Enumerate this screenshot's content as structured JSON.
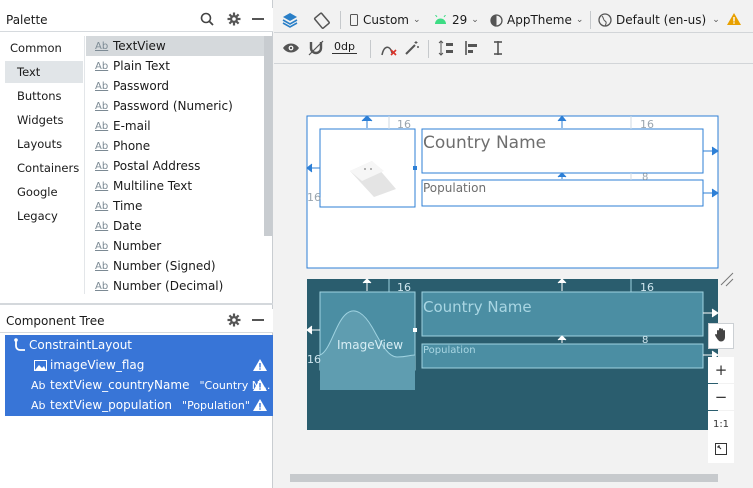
{
  "palette": {
    "title": "Palette",
    "categories": [
      "Common",
      "Text",
      "Buttons",
      "Widgets",
      "Layouts",
      "Containers",
      "Google",
      "Legacy"
    ],
    "items": [
      "TextView",
      "Plain Text",
      "Password",
      "Password (Numeric)",
      "E-mail",
      "Phone",
      "Postal Address",
      "Multiline Text",
      "Time",
      "Date",
      "Number",
      "Number (Signed)",
      "Number (Decimal)"
    ],
    "ab_glyph": "Ab"
  },
  "component_tree": {
    "title": "Component Tree",
    "root": "ConstraintLayout",
    "children": [
      {
        "id": "imageView_flag",
        "icon": "image-icon",
        "text": ""
      },
      {
        "id": "textView_countryName",
        "icon": "ab",
        "text": "\"Country N..."
      },
      {
        "id": "textView_population",
        "icon": "ab",
        "text": "\"Population\""
      }
    ],
    "ab_glyph": "Ab"
  },
  "toolbar": {
    "device": "Custom",
    "api": "29",
    "theme": "AppTheme",
    "locale": "Default (en-us)",
    "margin": "0dp"
  },
  "blueprint": {
    "margin_16": "16",
    "margin_8": "8",
    "country_name": "Country Name",
    "population": "Population",
    "imageview_label": "ImageView"
  },
  "zoom": {
    "one_to_one": "1:1"
  },
  "colors": {
    "selection": "#3875d7",
    "blueprint_bg": "#2a5d6e",
    "design_outline": "#2d7fd6",
    "warning": "#e8a000"
  }
}
